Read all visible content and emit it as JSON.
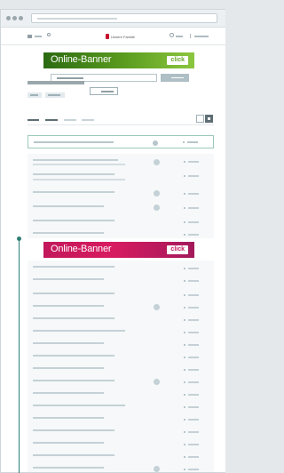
{
  "browser": {
    "traffic_lights": [
      "close",
      "minimize",
      "maximize"
    ]
  },
  "site": {
    "logo_text": "Unsere Familie",
    "brand_color": "#c8102e"
  },
  "banners": [
    {
      "label": "Online-Banner",
      "cta": "click",
      "color": "#5c9d1f"
    },
    {
      "label": "Online-Banner",
      "cta": "click",
      "color": "#d81b60"
    }
  ],
  "colors": {
    "timeline": "#2e7e76",
    "highlight_border": "#9cc8b9"
  },
  "icons": {
    "menu": "hamburger-icon",
    "search": "search-icon",
    "account": "user-icon",
    "grid_view": "grid-icon",
    "list_view": "list-icon"
  }
}
